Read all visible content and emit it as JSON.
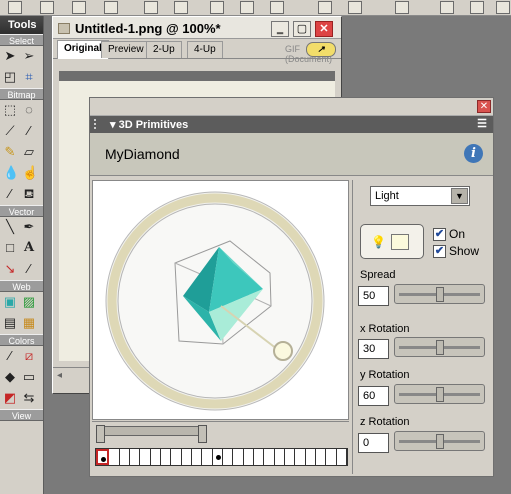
{
  "tools": {
    "title": "Tools",
    "sections": [
      "Select",
      "Bitmap",
      "Vector",
      "Web",
      "Colors",
      "View"
    ]
  },
  "document": {
    "title": "Untitled-1.png @ 100%*",
    "tabs": [
      "Original",
      "Preview",
      "2-Up",
      "4-Up"
    ],
    "active_tab": "Original",
    "format_info": "GIF (Document)"
  },
  "panel": {
    "title": "3D Primitives",
    "object_name": "MyDiamond",
    "light_select": "Light",
    "on_label": "On",
    "show_label": "Show",
    "on_checked": true,
    "show_checked": true,
    "spread": {
      "label": "Spread",
      "value": "50",
      "level": 0.5
    },
    "x_rotation": {
      "label": "x Rotation",
      "value": "30",
      "level": 0.5
    },
    "y_rotation": {
      "label": "y Rotation",
      "value": "60",
      "level": 0.5
    },
    "z_rotation": {
      "label": "z Rotation",
      "value": "0",
      "level": 0.5
    },
    "timeline": {
      "frame_count": 24,
      "current_frame": 1,
      "keyframes": [
        1,
        12
      ]
    }
  },
  "colors": {
    "diamond_dark": "#1f9e98",
    "diamond_mid": "#3dc7bc",
    "diamond_light": "#a9ecd8",
    "accent_red": "#c52626"
  }
}
